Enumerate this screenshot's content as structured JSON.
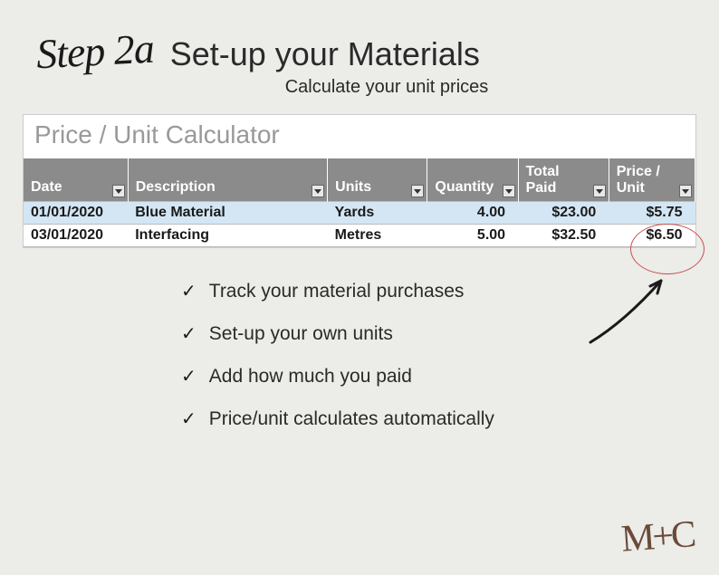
{
  "header": {
    "step": "Step 2a",
    "title": "Set-up your Materials",
    "subtitle": "Calculate your unit prices"
  },
  "sheet": {
    "title": "Price / Unit Calculator",
    "columns": {
      "date": "Date",
      "description": "Description",
      "units": "Units",
      "quantity": "Quantity",
      "total_paid_l1": "Total",
      "total_paid_l2": "Paid",
      "price_unit_l1": "Price /",
      "price_unit_l2": "Unit"
    },
    "rows": [
      {
        "date": "01/01/2020",
        "description": "Blue Material",
        "units": "Yards",
        "quantity": "4.00",
        "total_paid": "$23.00",
        "price_unit": "$5.75"
      },
      {
        "date": "03/01/2020",
        "description": "Interfacing",
        "units": "Metres",
        "quantity": "5.00",
        "total_paid": "$32.50",
        "price_unit": "$6.50"
      }
    ]
  },
  "bullets": [
    "Track your material purchases",
    "Set-up your own units",
    "Add how much you paid",
    "Price/unit calculates automatically"
  ],
  "logo": "M+C"
}
